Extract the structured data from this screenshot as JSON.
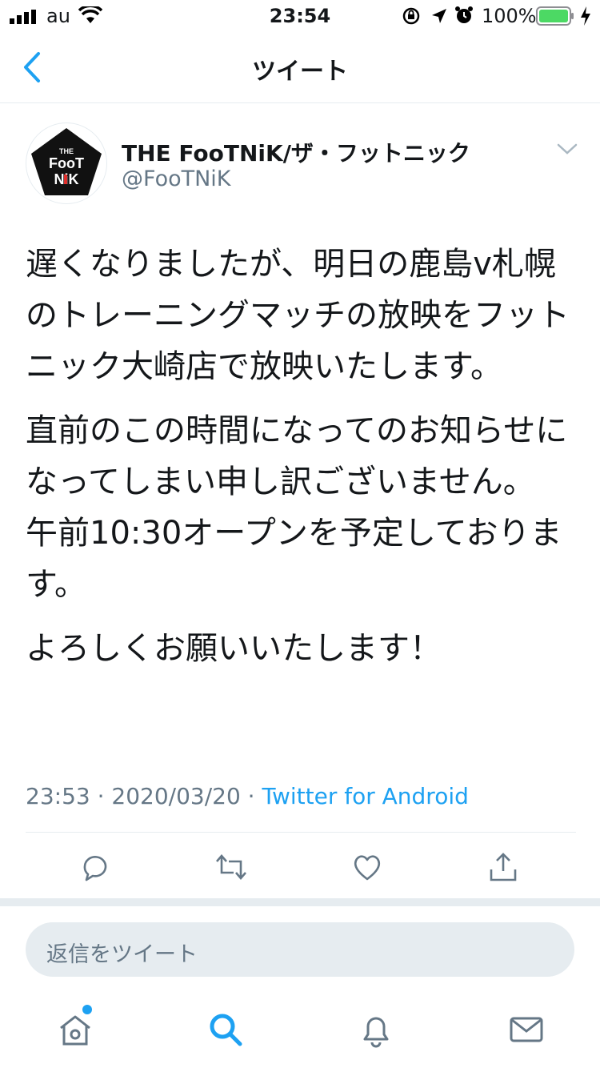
{
  "status_bar": {
    "carrier": "au",
    "time": "23:54",
    "battery": "100%",
    "icons": [
      "signal-icon",
      "wifi-icon",
      "rotation-lock-icon",
      "location-icon",
      "alarm-icon",
      "battery-icon",
      "charging-icon"
    ]
  },
  "nav": {
    "title": "ツイート",
    "back_icon": "back-chevron-icon"
  },
  "tweet": {
    "author_name": "THE FooTNiK/ザ・フットニック",
    "handle": "@FooTNiK",
    "avatar_text": [
      "THE",
      "FooT",
      "NiK"
    ],
    "paragraphs": [
      "遅くなりましたが、明日の鹿島v札幌のトレーニングマッチの放映をフットニック大崎店で放映いたします。",
      "直前のこの時間になってのお知らせになってしまい申し訳ございません。\n午前10:30オープンを予定しております。",
      "よろしくお願いいたします！"
    ],
    "timestamp": "23:53 · 2020/03/20 · ",
    "source": "Twitter for Android"
  },
  "actions": [
    "reply-icon",
    "retweet-icon",
    "like-icon",
    "share-icon"
  ],
  "reply_box": {
    "placeholder": "返信をツイート"
  },
  "tabbar": [
    "home-icon",
    "search-icon",
    "notifications-icon",
    "messages-icon"
  ],
  "colors": {
    "accent": "#1da1f2",
    "text": "#14171a",
    "secondary": "#657786",
    "divider": "#e6ecf0",
    "battery": "#4cd964",
    "logo_red": "#e0302d"
  }
}
